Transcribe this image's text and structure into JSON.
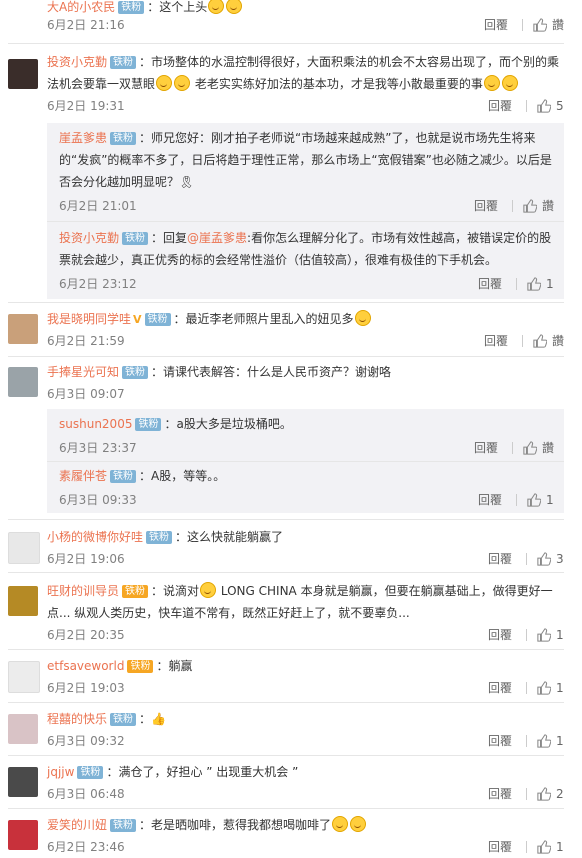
{
  "icons": {
    "like": "thumbs-up-icon",
    "emoji": "smiley-emoji-icon"
  },
  "reply_label": "回覆",
  "zan_label": "讚",
  "colors": {
    "username": "#eb7350",
    "badge": "#7fb3d6",
    "subbg": "#f2f2f5"
  },
  "c0": {
    "user": "大A的小农民",
    "badge": "铁粉",
    "text": "：这个上头",
    "time": "6月2日 21:16"
  },
  "c1": {
    "user": "投资小克勤",
    "badge": "铁粉",
    "text": "：市场整体的水温控制得很好，大面积乘法的机会不太容易出现了，而个别的乘法机会要靠一双慧眼",
    "text2": " 老老实实练好加法的基本功，才是我等小散最重要的事",
    "time": "6月2日 19:31",
    "likes": "5"
  },
  "c1r1": {
    "user": "崖孟爹患",
    "badge": "铁粉",
    "text": "：师兄您好：刚才拍子老师说“市场越来越成熟”了，也就是说市场先生将来的“发疯”的概率不多了，日后将趋于理性正常，那么市场上“宽假错案”也必随之减少。以后是否会分化越加明显呢？🎗",
    "time": "6月2日 21:01"
  },
  "c1r2": {
    "user": "投资小克勤",
    "badge": "铁粉",
    "text_a": "：回复",
    "mention": "@崖孟爹患",
    "text_b": ":看你怎么理解分化了。市场有效性越高，被错误定价的股票就会越少，真正优秀的标的会经常性溢价（估值较高），很难有极佳的下手机会。",
    "time": "6月2日 23:12",
    "likes": "1"
  },
  "c2": {
    "user": "我是晓明同学哇",
    "vip": "V",
    "badge": "铁粉",
    "text": "：最近李老师照片里乱入的妞见多",
    "time": "6月2日 21:59"
  },
  "c3": {
    "user": "手捧星光可知",
    "badge": "铁粉",
    "text": "：请课代表解答：什么是人民币资产？谢谢咯",
    "time": "6月3日 09:07"
  },
  "c3r1": {
    "user": "sushun2005",
    "badge": "铁粉",
    "text": "：a股大多是垃圾桶吧。",
    "time": "6月3日 23:37"
  },
  "c3r2": {
    "user": "素履伴苍",
    "badge": "铁粉",
    "text": "：A股，等等。。",
    "time": "6月3日 09:33",
    "likes": "1"
  },
  "c4": {
    "user": "小杨的微博你好哇",
    "badge": "铁粉",
    "text": "：这么快就能躺赢了",
    "time": "6月2日 19:06",
    "likes": "3"
  },
  "c5": {
    "user": "旺财的训导员",
    "badge": "铁粉",
    "text": "：说滴对",
    "text2": " LONG CHINA 本身就是躺赢，但要在躺赢基础上，做得更好一点... 纵观人类历史，快车道不常有，既然正好赶上了，就不要辜负...",
    "time": "6月2日 20:35",
    "likes": "1"
  },
  "c6": {
    "user": "etfsaveworld",
    "badge": "铁粉",
    "text": "：躺赢",
    "time": "6月2日 19:03",
    "likes": "1"
  },
  "c7": {
    "user": "程囍的快乐",
    "badge": "铁粉",
    "text": "：👍",
    "time": "6月3日 09:32",
    "likes": "1"
  },
  "c8": {
    "user": "jqjjw",
    "badge": "铁粉",
    "text": "：满仓了，好担心 ” 出现重大机会 ”",
    "time": "6月3日 06:48",
    "likes": "2"
  },
  "c9": {
    "user": "爱笑的川妞",
    "badge": "铁粉",
    "text": "：老是晒咖啡，惹得我都想喝咖啡了",
    "time": "6月2日 23:46",
    "likes": "1"
  }
}
